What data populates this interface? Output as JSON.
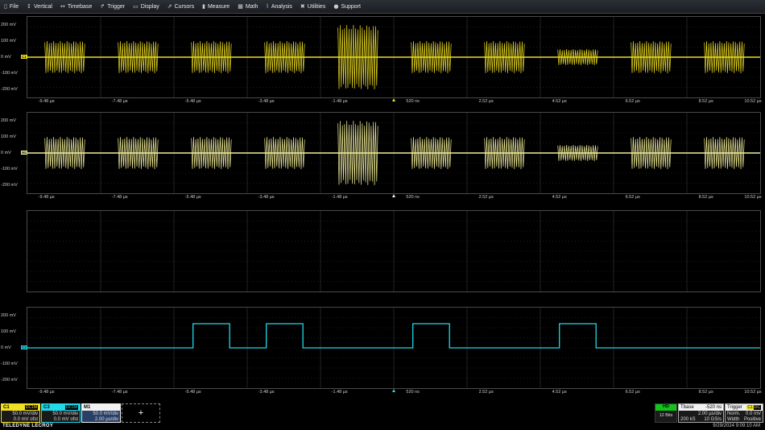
{
  "menu": [
    {
      "label": "File",
      "icon": "file-icon",
      "glyph": "▯"
    },
    {
      "label": "Vertical",
      "icon": "vertical-icon",
      "glyph": "↕"
    },
    {
      "label": "Timebase",
      "icon": "timebase-icon",
      "glyph": "↔"
    },
    {
      "label": "Trigger",
      "icon": "trigger-icon",
      "glyph": "↱"
    },
    {
      "label": "Display",
      "icon": "display-icon",
      "glyph": "▭"
    },
    {
      "label": "Cursors",
      "icon": "cursors-icon",
      "glyph": "⇗"
    },
    {
      "label": "Measure",
      "icon": "measure-icon",
      "glyph": "▮"
    },
    {
      "label": "Math",
      "icon": "math-icon",
      "glyph": "▦"
    },
    {
      "label": "Analysis",
      "icon": "analysis-icon",
      "glyph": "⌇"
    },
    {
      "label": "Utilities",
      "icon": "utilities-icon",
      "glyph": "✖"
    },
    {
      "label": "Support",
      "icon": "support-icon",
      "glyph": "●"
    }
  ],
  "colors": {
    "c1": "#f0e020",
    "c1_light": "#f3ef9a",
    "c3": "#20d8e8",
    "grid": "#3a3a3a",
    "m1": "#f2f2f2"
  },
  "x_ticks": [
    "-9.48 µs",
    "-7.48 µs",
    "-5.48 µs",
    "-3.48 µs",
    "-1.48 µs",
    "520 ns",
    "2.52 µs",
    "4.52 µs",
    "6.52 µs",
    "8.52 µs",
    "10.52 µs"
  ],
  "y_ticks": [
    "200 mV",
    "100 mV",
    "0 mV",
    "-100 mV",
    "-200 mV"
  ],
  "grids": {
    "g1": {
      "tag": "C1"
    },
    "g2": {
      "tag": "M1"
    },
    "g4": {
      "tag": "C3"
    }
  },
  "bursts": [
    {
      "t": -9.48,
      "amp": 100
    },
    {
      "t": -7.48,
      "amp": 100
    },
    {
      "t": -5.48,
      "amp": 100
    },
    {
      "t": -3.48,
      "amp": 100
    },
    {
      "t": -1.48,
      "amp": 200
    },
    {
      "t": 0.52,
      "amp": 100
    },
    {
      "t": 2.52,
      "amp": 100
    },
    {
      "t": 4.52,
      "amp": 50
    },
    {
      "t": 6.52,
      "amp": 100
    },
    {
      "t": 8.52,
      "amp": 100
    }
  ],
  "square_high": [
    [
      -5.48,
      -4.48
    ],
    [
      -3.48,
      -2.48
    ],
    [
      0.52,
      1.52
    ],
    [
      4.52,
      5.52
    ]
  ],
  "square_level_mv": 150,
  "descriptors": {
    "c1": {
      "name": "C1",
      "coupling": "DC1M",
      "scale": "50.0 mV/div",
      "offset": "0.0 mV ofst"
    },
    "c3": {
      "name": "C3",
      "coupling": "DC1M",
      "scale": "50.0 mV/div",
      "offset": "0.0 mV ofst"
    },
    "m1": {
      "name": "M1",
      "scale": "50.0 mV/div",
      "timebase": "2.00 µs/div"
    },
    "add": "+",
    "hd": {
      "label": "HD",
      "bits": "12 Bits"
    },
    "tbase": {
      "label": "Tbase",
      "delay": "-520 ns",
      "per_div": "2.00 µs/div",
      "samples": "200 kS",
      "rate": "10 GS/s"
    },
    "trigger": {
      "label": "Trigger",
      "source": "C1",
      "coupling": "DC",
      "mode": "Norm.",
      "level": "0.0 mV",
      "type": "Width",
      "slope": "Positive"
    }
  },
  "brand": "TELEDYNE LECROY",
  "datetime": "9/29/2024 9:09:10 AM"
}
